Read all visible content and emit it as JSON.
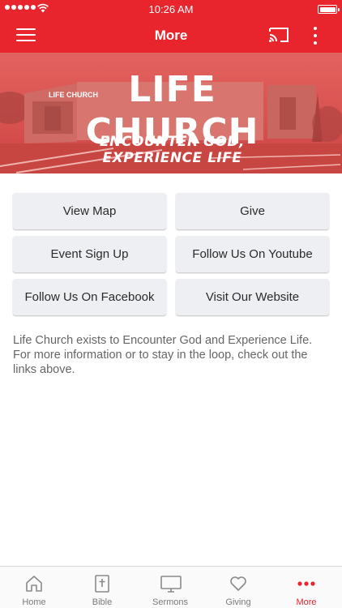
{
  "status_bar": {
    "time": "10:26 AM"
  },
  "header": {
    "title": "More"
  },
  "banner": {
    "headline": "LIFE CHURCH",
    "tagline": "ENCOUNTER GOD, EXPERIENCE LIFE"
  },
  "buttons": [
    {
      "label": "View Map"
    },
    {
      "label": "Give"
    },
    {
      "label": "Event Sign Up"
    },
    {
      "label": "Follow Us On Youtube"
    },
    {
      "label": "Follow Us On Facebook"
    },
    {
      "label": "Visit Our Website"
    }
  ],
  "description": "Life Church exists to Encounter God and Experience Life. For more information or to stay in the loop, check out the links above.",
  "tabbar": {
    "active_index": 4,
    "accent_color": "#e8242c",
    "items": [
      {
        "label": "Home",
        "icon": "home-icon"
      },
      {
        "label": "Bible",
        "icon": "bible-icon"
      },
      {
        "label": "Sermons",
        "icon": "monitor-icon"
      },
      {
        "label": "Giving",
        "icon": "heart-icon"
      },
      {
        "label": "More",
        "icon": "more-dots-icon"
      }
    ]
  },
  "colors": {
    "primary": "#e8242c",
    "button_bg": "#eeeff2",
    "text_muted": "#666666"
  }
}
